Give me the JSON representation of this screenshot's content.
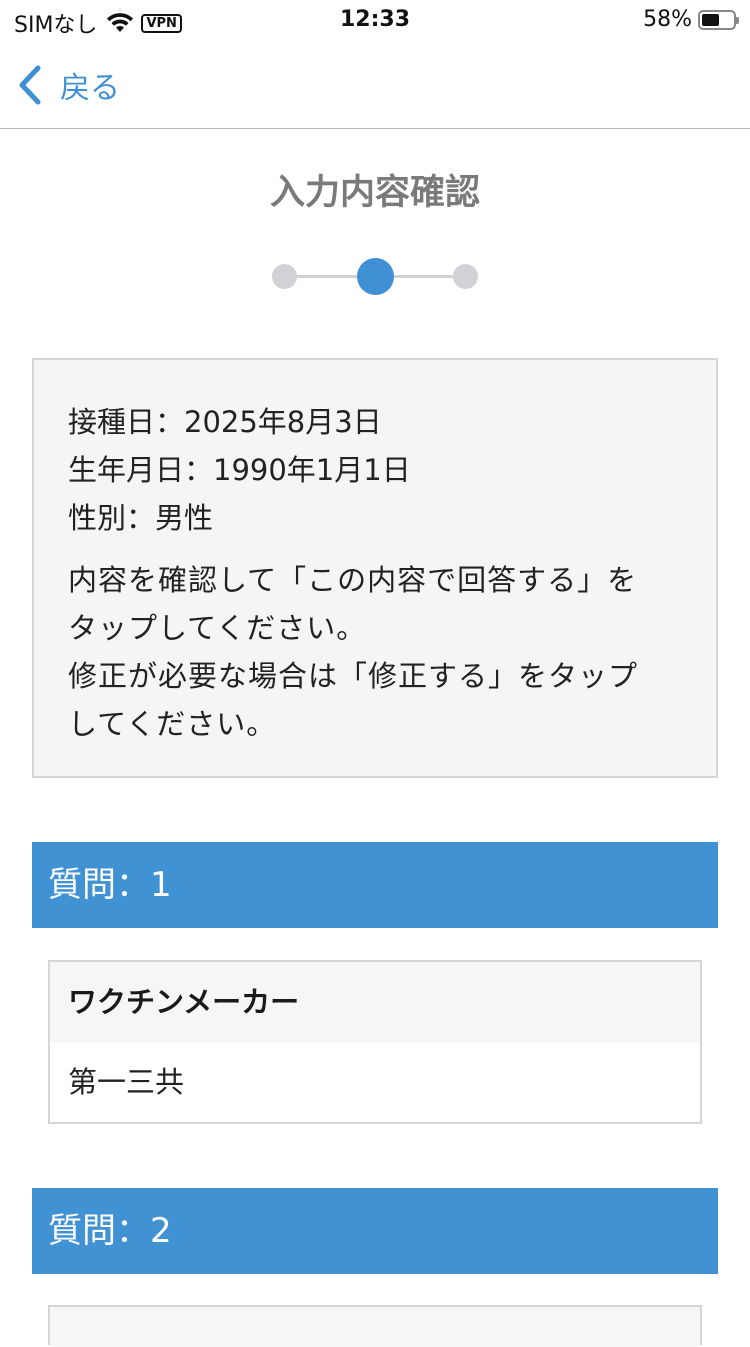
{
  "status_bar": {
    "carrier": "SIMなし",
    "vpn": "VPN",
    "time": "12:33",
    "battery_text": "58%",
    "battery_level": 0.58,
    "icons": [
      "wifi-icon",
      "vpn-badge",
      "battery-icon"
    ]
  },
  "nav": {
    "back_label": "戻る",
    "back_icon": "chevron-left-icon",
    "accent_color": "#3f8fd4"
  },
  "page": {
    "title": "入力内容確認",
    "stepper": {
      "steps": 3,
      "current": 2,
      "active_color": "#3f8fd4",
      "inactive_color": "#d0d2d6"
    }
  },
  "summary": {
    "vaccination_date": "接種日：2025年8月3日",
    "birth_date": "生年月日：1990年1月1日",
    "gender": "性別：男性",
    "instructions": [
      "内容を確認して「この内容で回答する」を",
      "タップしてください。",
      "修正が必要な場合は「修正する」をタップ",
      "してください。"
    ]
  },
  "questions": [
    {
      "header": "質問：1",
      "item_label": "ワクチンメーカー",
      "item_value": "第一三共"
    },
    {
      "header": "質問：2"
    }
  ],
  "colors": {
    "question_header_bg": "#4192d3",
    "summary_bg": "#f5f5f5"
  }
}
